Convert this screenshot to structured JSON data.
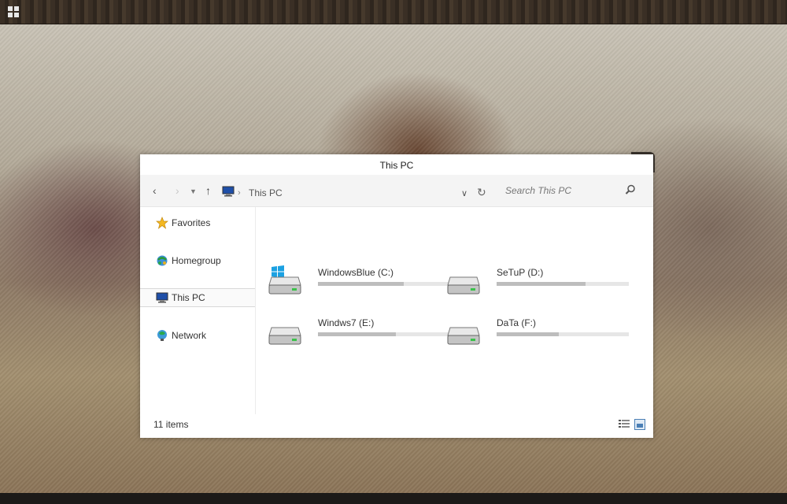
{
  "window": {
    "title": "This PC"
  },
  "navigation": {
    "back_icon": "back-arrow-icon",
    "forward_icon": "forward-arrow-icon",
    "up_icon": "up-arrow-icon",
    "breadcrumb": "This PC",
    "search_placeholder": "Search This PC"
  },
  "sidebar": {
    "items": [
      {
        "label": "Favorites",
        "icon": "star-icon"
      },
      {
        "label": "Homegroup",
        "icon": "homegroup-icon"
      },
      {
        "label": "This PC",
        "icon": "computer-icon",
        "selected": true
      },
      {
        "label": "Network",
        "icon": "network-icon"
      }
    ]
  },
  "drives": [
    {
      "label": "WindowsBlue (C:)",
      "usage": 0.65,
      "system": true
    },
    {
      "label": "SeTuP (D:)",
      "usage": 0.67
    },
    {
      "label": "Windws7 (E:)",
      "usage": 0.59
    },
    {
      "label": "DaTa (F:)",
      "usage": 0.47
    }
  ],
  "status": {
    "items_count": "11 items"
  },
  "colors": {
    "window_bg": "#ffffff",
    "nav_bg": "#f4f4f4",
    "taskbar": "#3a2f25",
    "drive_bar_bg": "#e6e6e6",
    "drive_bar_fill": "#bdbdbd",
    "windows_logo": "#1ba1e2"
  }
}
